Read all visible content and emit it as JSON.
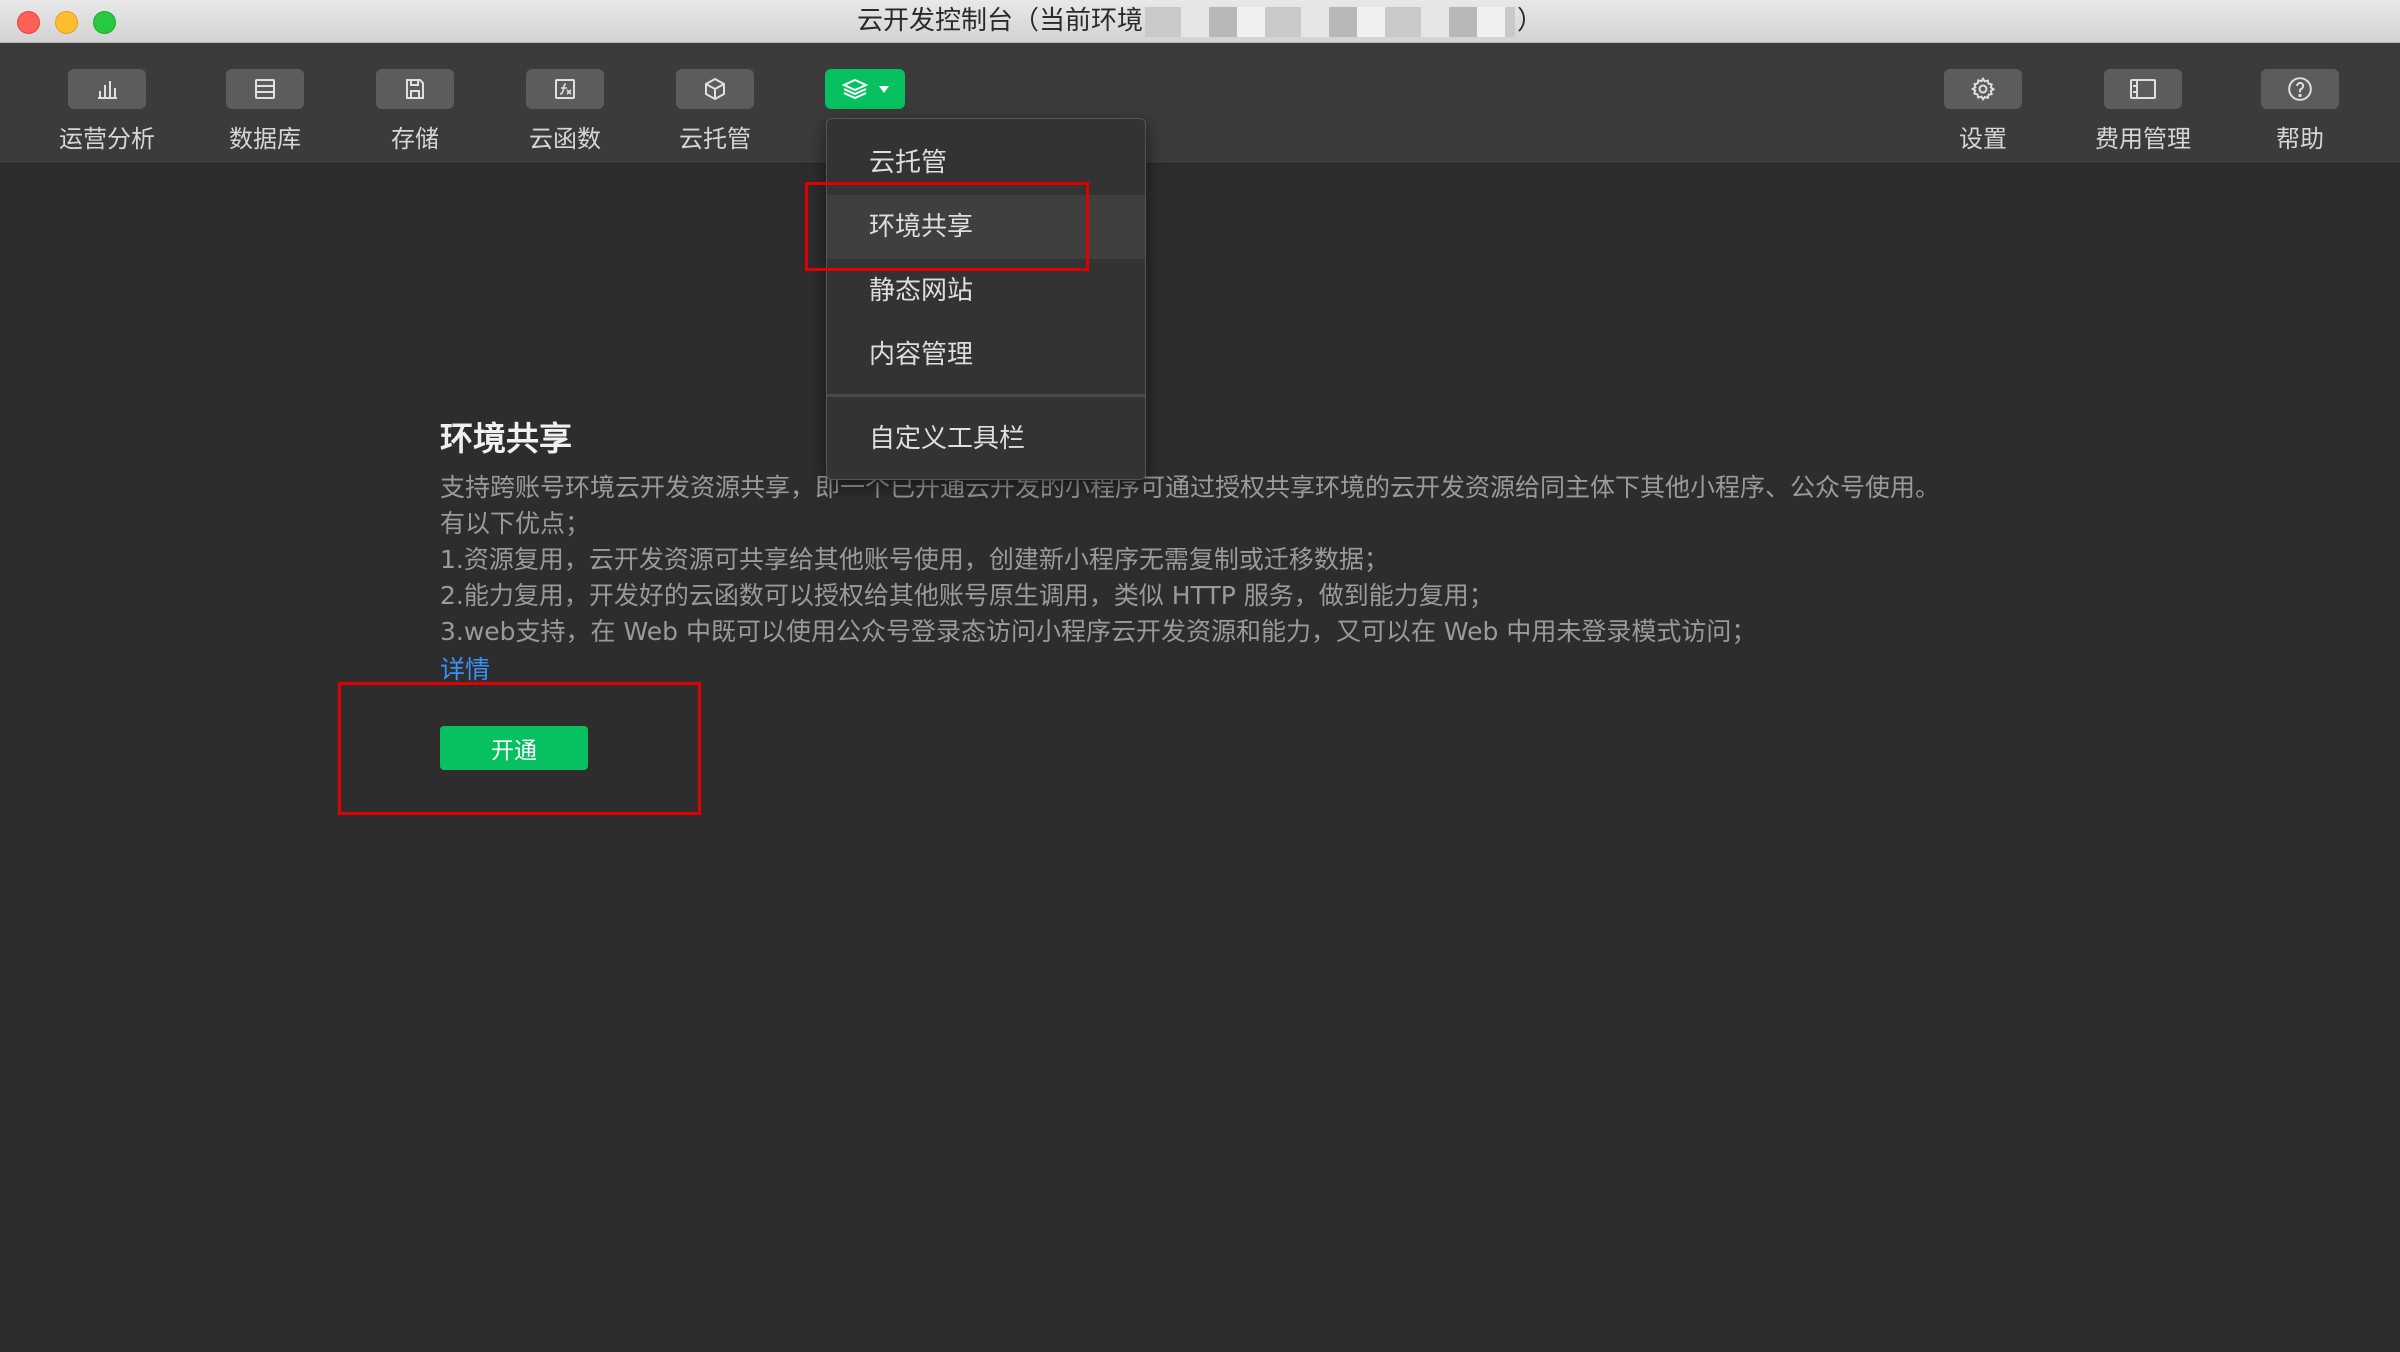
{
  "window": {
    "title_prefix": "云开发控制台（当前环境",
    "title_suffix": "）"
  },
  "toolbar": {
    "left": [
      {
        "label": "运营分析",
        "icon": "bar-chart-icon"
      },
      {
        "label": "数据库",
        "icon": "database-icon"
      },
      {
        "label": "存储",
        "icon": "storage-icon"
      },
      {
        "label": "云函数",
        "icon": "function-icon"
      },
      {
        "label": "云托管",
        "icon": "cube-icon"
      }
    ],
    "more": {
      "icon": "layers-icon"
    },
    "right": [
      {
        "label": "设置",
        "icon": "gear-icon"
      },
      {
        "label": "费用管理",
        "icon": "billing-icon"
      },
      {
        "label": "帮助",
        "icon": "help-icon"
      }
    ]
  },
  "dropdown": {
    "items": [
      "云托管",
      "环境共享",
      "静态网站",
      "内容管理"
    ],
    "footer": "自定义工具栏"
  },
  "content": {
    "title": "环境共享",
    "lines": [
      "支持跨账号环境云开发资源共享，即一个已开通云开发的小程序可通过授权共享环境的云开发资源给同主体下其他小程序、公众号使用。有以下优点；",
      "1.资源复用，云开发资源可共享给其他账号使用，创建新小程序无需复制或迁移数据；",
      "2.能力复用，开发好的云函数可以授权给其他账号原生调用，类似 HTTP 服务，做到能力复用；",
      "3.web支持，在 Web 中既可以使用公众号登录态访问小程序云开发资源和能力，又可以在 Web 中用未登录模式访问；"
    ],
    "detail_link": "详情",
    "open_button": "开通"
  },
  "colors": {
    "accent": "#07c160",
    "link": "#3e8ff5",
    "highlight": "#e00000"
  }
}
